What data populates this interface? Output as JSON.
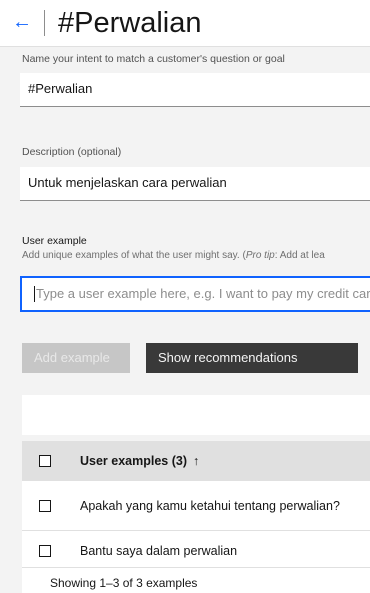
{
  "header": {
    "back_icon": "arrow-left-icon",
    "back_glyph": "←",
    "title": "#Perwalian"
  },
  "intent_name": {
    "label": "Name your intent to match a customer's question or goal",
    "value": "#Perwalian"
  },
  "description": {
    "label": "Description (optional)",
    "value": "Untuk menjelaskan cara perwalian"
  },
  "user_example": {
    "label": "User example",
    "helper_prefix": "Add unique examples of what the user might say. (",
    "helper_tip_label": "Pro tip",
    "helper_suffix": ": Add at lea",
    "placeholder": "Type a user example here, e.g. I want to pay my credit car"
  },
  "buttons": {
    "add_example": "Add example",
    "show_recommendations": "Show recommendations"
  },
  "table": {
    "header": "User examples (3)",
    "sort_glyph": "↑",
    "rows": [
      "Apakah yang kamu ketahui tentang perwalian?",
      "Bantu saya dalam perwalian"
    ]
  },
  "footer": {
    "showing": "Showing 1–3 of 3 examples"
  },
  "colors": {
    "accent": "#0f62fe",
    "dark_button": "#393939",
    "disabled_button": "#c6c6c6"
  }
}
